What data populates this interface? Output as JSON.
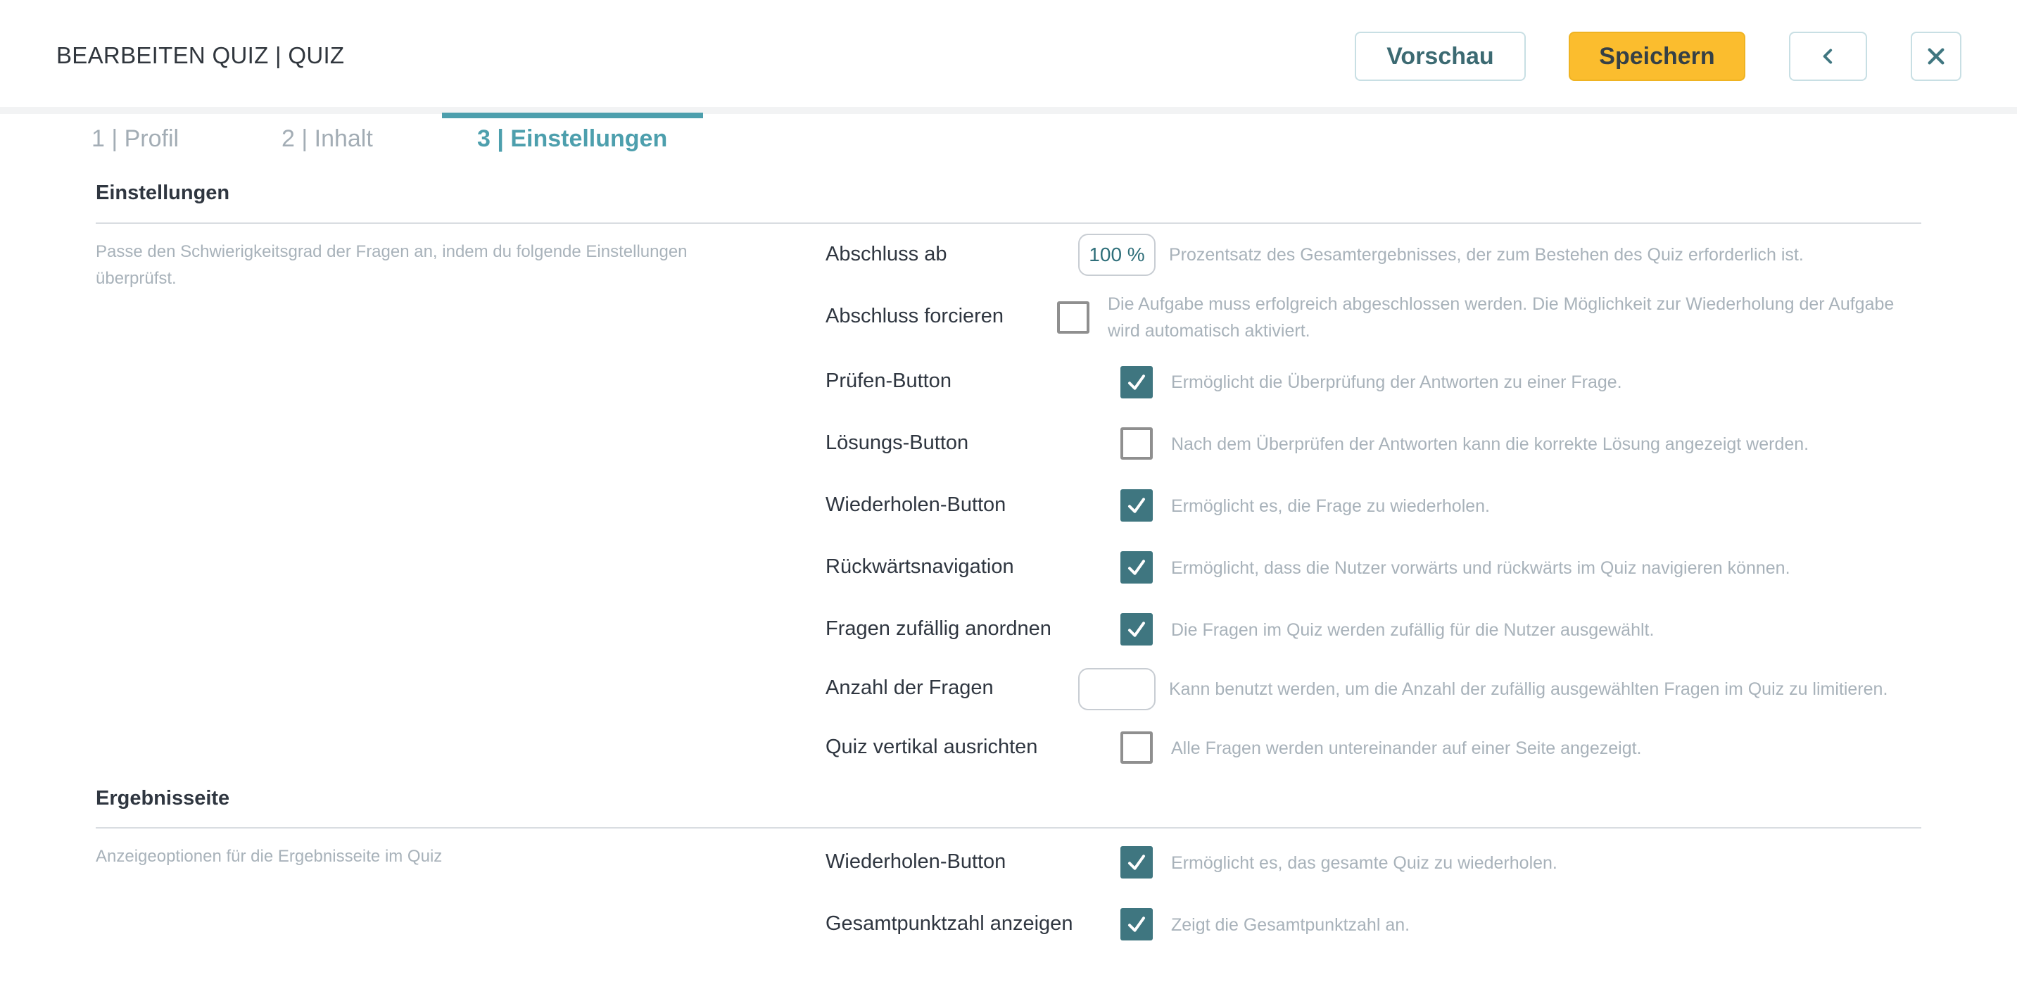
{
  "header": {
    "title": "BEARBEITEN QUIZ | QUIZ",
    "preview_label": "Vorschau",
    "save_label": "Speichern",
    "back_icon": "chevron-left-icon",
    "close_icon": "close-icon"
  },
  "tabs": [
    {
      "label": "1 | Profil",
      "active": false
    },
    {
      "label": "2 | Inhalt",
      "active": false
    },
    {
      "label": "3 | Einstellungen",
      "active": true
    }
  ],
  "settings": {
    "section_title": "Einstellungen",
    "description": "Passe den Schwierigkeitsgrad der Fragen an, indem du folgende Einstellungen überprüfst.",
    "rows": [
      {
        "label": "Abschluss ab",
        "type": "input",
        "value": "100 %",
        "help": "Prozentsatz des Gesamtergebnisses, der zum Bestehen des Quiz erforderlich ist."
      },
      {
        "label": "Abschluss forcieren",
        "type": "checkbox",
        "checked": false,
        "help": "Die Aufgabe muss erfolgreich abgeschlossen werden. Die Möglichkeit zur Wiederholung der Aufgabe wird automatisch aktiviert."
      },
      {
        "label": "Prüfen-Button",
        "type": "checkbox",
        "checked": true,
        "help": "Ermöglicht die Überprüfung der Antworten zu einer Frage."
      },
      {
        "label": "Lösungs-Button",
        "type": "checkbox",
        "checked": false,
        "help": "Nach dem Überprüfen der Antworten kann die korrekte Lösung angezeigt werden."
      },
      {
        "label": "Wiederholen-Button",
        "type": "checkbox",
        "checked": true,
        "help": "Ermöglicht es, die Frage zu wiederholen."
      },
      {
        "label": "Rückwärtsnavigation",
        "type": "checkbox",
        "checked": true,
        "help": "Ermöglicht, dass die Nutzer vorwärts und rückwärts im Quiz navigieren können."
      },
      {
        "label": "Fragen zufällig anordnen",
        "type": "checkbox",
        "checked": true,
        "help": "Die Fragen im Quiz werden zufällig für die Nutzer ausgewählt."
      },
      {
        "label": "Anzahl der Fragen",
        "type": "input",
        "value": "",
        "help": "Kann benutzt werden, um die Anzahl der zufällig ausgewählten Fragen im Quiz zu limitieren."
      },
      {
        "label": "Quiz vertikal ausrichten",
        "type": "checkbox",
        "checked": false,
        "help": "Alle Fragen werden untereinander auf einer Seite angezeigt."
      }
    ]
  },
  "results": {
    "section_title": "Ergebnisseite",
    "description": "Anzeigeoptionen für die Ergebnisseite im Quiz",
    "rows": [
      {
        "label": "Wiederholen-Button",
        "type": "checkbox",
        "checked": true,
        "help": "Ermöglicht es, das gesamte Quiz zu wiederholen."
      },
      {
        "label": "Gesamtpunktzahl anzeigen",
        "type": "checkbox",
        "checked": true,
        "help": "Zeigt die Gesamtpunktzahl an."
      }
    ]
  },
  "colors": {
    "accent": "#4d9fad",
    "checkbox_checked": "#3f7680",
    "save_button": "#fbbd2e"
  }
}
